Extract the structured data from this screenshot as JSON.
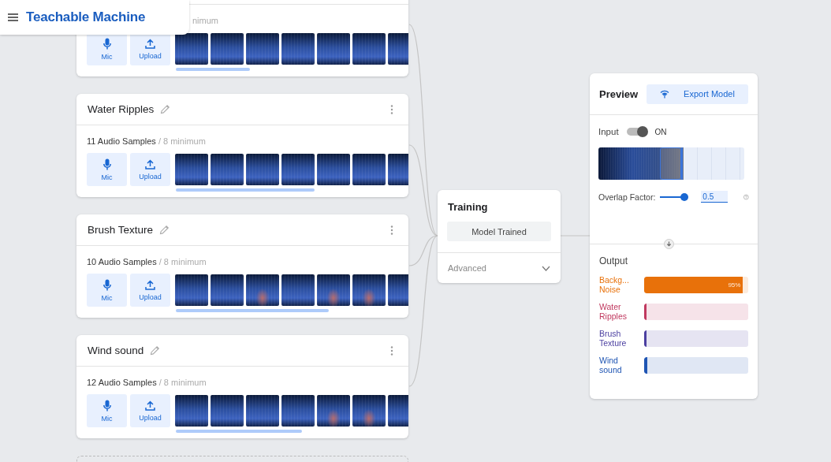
{
  "header": {
    "title": "Teachable Machine"
  },
  "classes": [
    {
      "kind": "partial",
      "minimum": "nimum",
      "mic_label": "Mic",
      "upload_label": "Upload"
    },
    {
      "kind": "full",
      "name": "Water Ripples",
      "count": "11 Audio Samples",
      "minimum": "/ 8 minimum",
      "mic_label": "Mic",
      "upload_label": "Upload"
    },
    {
      "kind": "full",
      "name": "Brush Texture",
      "count": "10 Audio Samples",
      "minimum": "/ 8 minimum",
      "mic_label": "Mic",
      "upload_label": "Upload"
    },
    {
      "kind": "full",
      "name": "Wind sound",
      "count": "12 Audio Samples",
      "minimum": "/ 8 minimum",
      "mic_label": "Mic",
      "upload_label": "Upload"
    }
  ],
  "training": {
    "title": "Training",
    "button": "Model Trained",
    "advanced": "Advanced",
    "expanded": false
  },
  "preview": {
    "title": "Preview",
    "export_button": "Export Model",
    "input_label": "Input",
    "input_on": true,
    "input_state": "ON",
    "overlap_label": "Overlap Factor:",
    "overlap": {
      "level": 0.85
    },
    "overlap_value": "0.5",
    "output_title": "Output",
    "outputs": [
      {
        "label": "Backg... Noise",
        "color": "#e8710a",
        "level": 0.95,
        "reading": "95%"
      },
      {
        "label": "Water Ripples",
        "color": "#c0395f",
        "level": 0.01
      },
      {
        "label": "Brush Texture",
        "color": "#4b3fa0",
        "level": 0.01
      },
      {
        "label": "Wind sound",
        "color": "#1f55b3",
        "level": 0.03
      }
    ]
  }
}
